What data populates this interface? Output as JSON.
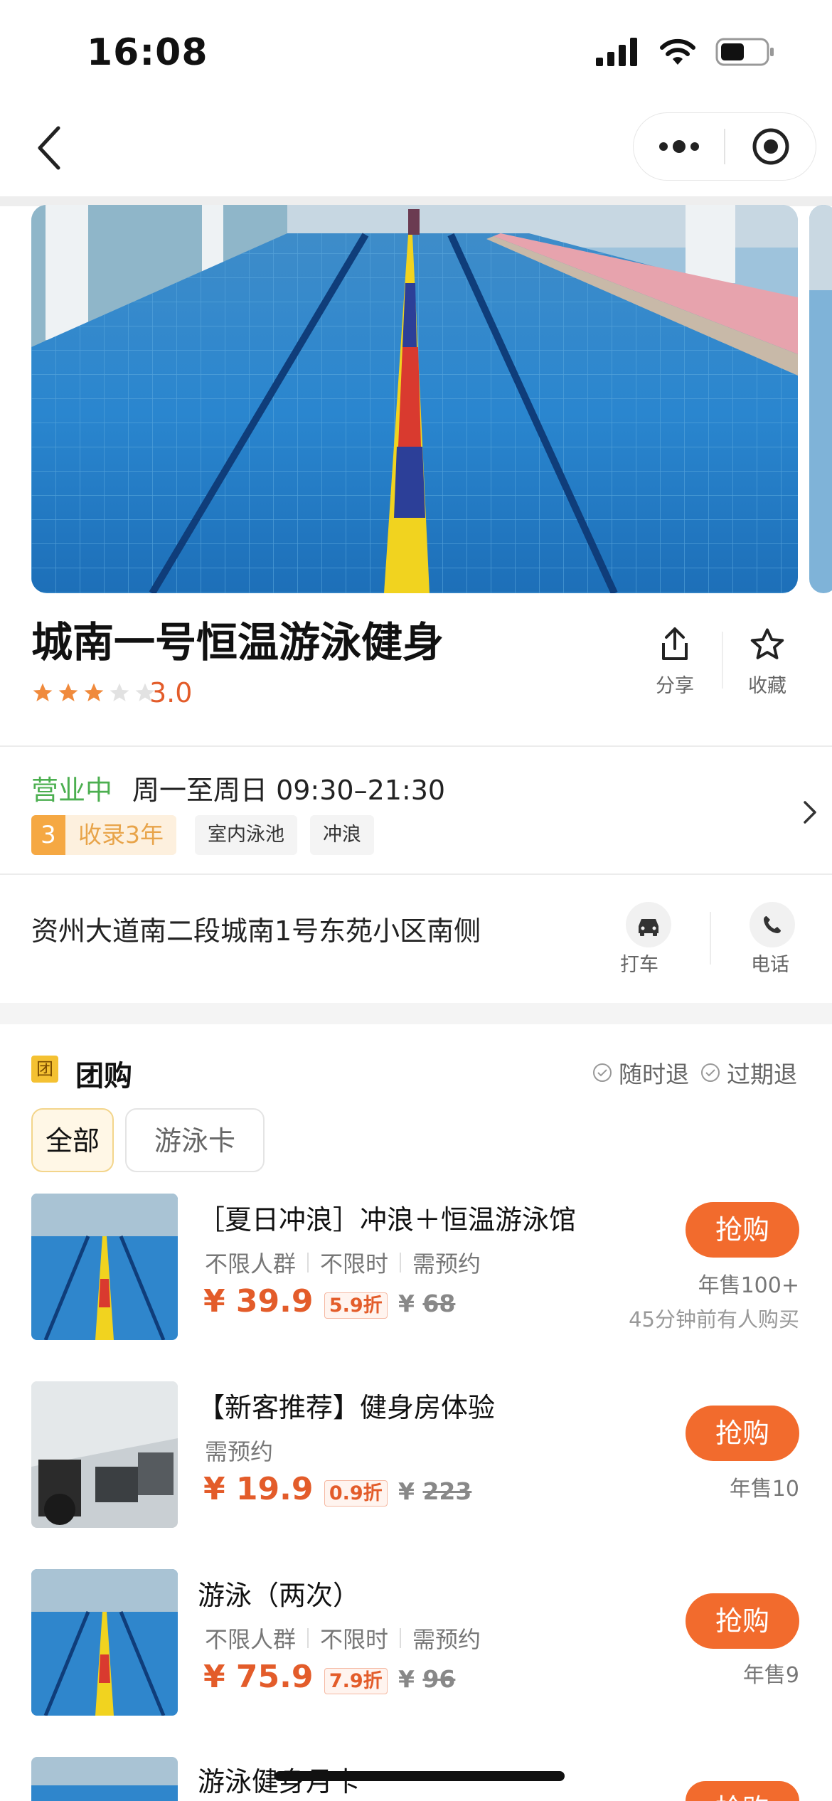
{
  "status": {
    "time": "16:08"
  },
  "shop": {
    "name": "城南一号恒温游泳健身",
    "rating": "3.0",
    "stars_filled": 3,
    "stars_total": 5,
    "share_label": "分享",
    "favorite_label": "收藏",
    "open_status": "营业中",
    "hours": "周一至周日 09:30–21:30",
    "badge_years_num": "3",
    "badge_years_label": "收录3年",
    "tags": [
      "室内泳池",
      "冲浪"
    ],
    "address": "资州大道南二段城南1号东苑小区南侧",
    "taxi_label": "打车",
    "phone_label": "电话"
  },
  "groupbuy": {
    "icon_text": "团",
    "title": "团购",
    "refund_anytime": "随时退",
    "refund_expired": "过期退",
    "tabs": [
      "全部",
      "游泳卡"
    ],
    "deals": [
      {
        "title": "［夏日冲浪］冲浪＋恒温游泳馆",
        "meta": [
          "不限人群",
          "不限时",
          "需预约"
        ],
        "price": "¥ 39.9",
        "discount": "5.9折",
        "orig_prefix": "¥ ",
        "orig": "68",
        "buy": "抢购",
        "sales": "年售100+",
        "recent": "45分钟前有人购买"
      },
      {
        "title": "【新客推荐】健身房体验",
        "meta": [
          "需预约"
        ],
        "price": "¥ 19.9",
        "discount": "0.9折",
        "orig_prefix": "¥ ",
        "orig": "223",
        "buy": "抢购",
        "sales": "年售10",
        "recent": ""
      },
      {
        "title": "游泳（两次）",
        "meta": [
          "不限人群",
          "不限时",
          "需预约"
        ],
        "price": "¥ 75.9",
        "discount": "7.9折",
        "orig_prefix": "¥ ",
        "orig": "96",
        "buy": "抢购",
        "sales": "年售9",
        "recent": ""
      },
      {
        "title": "游泳健身月卡",
        "meta": [],
        "price": "",
        "discount": "",
        "orig_prefix": "",
        "orig": "",
        "buy": "抢购",
        "sales": "",
        "recent": ""
      }
    ]
  },
  "colors": {
    "accent": "#f26b2d",
    "open": "#4caf50",
    "star": "#f08a3c"
  }
}
